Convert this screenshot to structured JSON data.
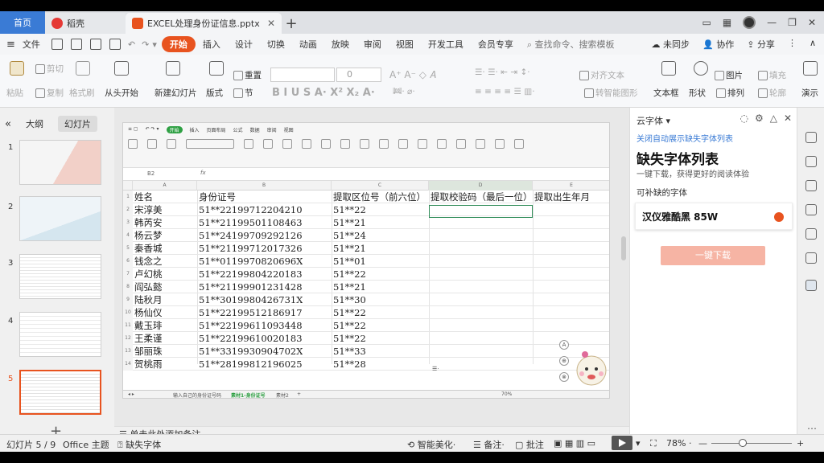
{
  "titlebar": {
    "home_tab": "首页",
    "docer_tab": "稻壳",
    "doc_tab": "EXCEL处理身份证信息.pptx"
  },
  "menubar": {
    "file": "文件",
    "items": [
      "开始",
      "插入",
      "设计",
      "切换",
      "动画",
      "放映",
      "审阅",
      "视图",
      "开发工具",
      "会员专享"
    ],
    "active": "开始",
    "search": "查找命令、搜索模板",
    "sync": "未同步",
    "collab": "协作",
    "share": "分享"
  },
  "ribbon": {
    "paste": "粘贴",
    "cut": "剪切",
    "copy": "复制",
    "format_painter": "格式刷",
    "from_start": "从头开始",
    "new_slide": "新建幻灯片",
    "layout": "版式",
    "section": "节",
    "reset": "重置",
    "font_size": "0",
    "align_text": "对齐文本",
    "smart_graphic": "转智能图形",
    "textbox": "文本框",
    "shape": "形状",
    "arrange": "排列",
    "fill": "填充",
    "outline": "轮廓",
    "image": "图片",
    "play": "演示"
  },
  "leftpane": {
    "tab_outline": "大纲",
    "tab_slides": "幻灯片",
    "slides": [
      "1",
      "2",
      "3",
      "4",
      "5"
    ],
    "selected": "5"
  },
  "sheet": {
    "headers": [
      "姓名",
      "身份证号",
      "提取区位号（前六位）",
      "提取校验码（最后一位）",
      "提取出生年月"
    ],
    "rows": [
      [
        "宋淳美",
        "51**22199712204210",
        "51**22"
      ],
      [
        "韩芮安",
        "51**21199501108463",
        "51**21"
      ],
      [
        "杨云梦",
        "51**24199709292126",
        "51**24"
      ],
      [
        "秦香城",
        "51**21199712017326",
        "51**21"
      ],
      [
        "钱念之",
        "51**0119970820696X",
        "51**01"
      ],
      [
        "卢幻桃",
        "51**22199804220183",
        "51**22"
      ],
      [
        "阎弘懿",
        "51**21199901231428",
        "51**21"
      ],
      [
        "陆秋月",
        "51**3019980426731X",
        "51**30"
      ],
      [
        "杨仙仪",
        "51**22199512186917",
        "51**22"
      ],
      [
        "戴玉琲",
        "51**22199611093448",
        "51**22"
      ],
      [
        "王柔谨",
        "51**22199610020183",
        "51**22"
      ],
      [
        "邹丽珠",
        "51**3319930904702X",
        "51**33"
      ],
      [
        "贺桃雨",
        "51**28199812196025",
        "51**28"
      ]
    ],
    "sheet_tabs": [
      "输入自己的身份证号码",
      "素材1-身份证号",
      "素材2"
    ],
    "zoom": "70%"
  },
  "notes": "单击此处添加备注",
  "rightpane": {
    "title": "云字体",
    "link": "关闭自动展示缺失字体列表",
    "heading": "缺失字体列表",
    "subtitle": "一键下载，获得更好的阅读体验",
    "section": "可补缺的字体",
    "font_name": "汉仪雅酷黑 85W",
    "download_btn": "一键下载"
  },
  "status": {
    "slide_counter": "幻灯片 5 / 9",
    "theme": "Office 主题",
    "missing_font": "缺失字体",
    "smart": "智能美化",
    "notes": "备注",
    "comment": "批注",
    "zoom": "78%"
  }
}
